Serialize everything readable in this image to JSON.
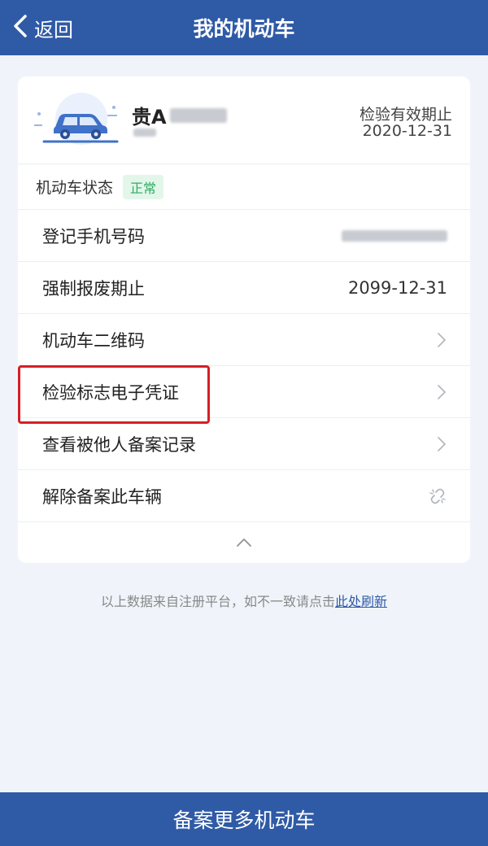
{
  "header": {
    "back_label": "返回",
    "title": "我的机动车"
  },
  "vehicle": {
    "plate_prefix": "贵A",
    "inspection_label": "检验有效期止",
    "inspection_date": "2020-12-31"
  },
  "status": {
    "label": "机动车状态",
    "badge": "正常"
  },
  "rows": [
    {
      "label": "登记手机号码"
    },
    {
      "label": "强制报废期止",
      "value": "2099-12-31"
    },
    {
      "label": "机动车二维码"
    },
    {
      "label": "检验标志电子凭证"
    },
    {
      "label": "查看被他人备案记录"
    },
    {
      "label": "解除备案此车辆"
    }
  ],
  "note": {
    "text": "以上数据来自注册平台，如不一致请点击",
    "link": "此处刷新"
  },
  "bottom_button": {
    "label": "备案更多机动车"
  },
  "colors": {
    "primary": "#2f5aa6",
    "badge_text": "#2eac60",
    "badge_bg": "#e3f6ea",
    "highlight": "#d61f26",
    "background": "#f0f4fa"
  },
  "icons": {
    "back": "chevron-left-icon",
    "car": "car-icon",
    "chevron": "chevron-right-icon",
    "unlink": "unlink-icon",
    "collapse": "chevron-up-icon"
  }
}
